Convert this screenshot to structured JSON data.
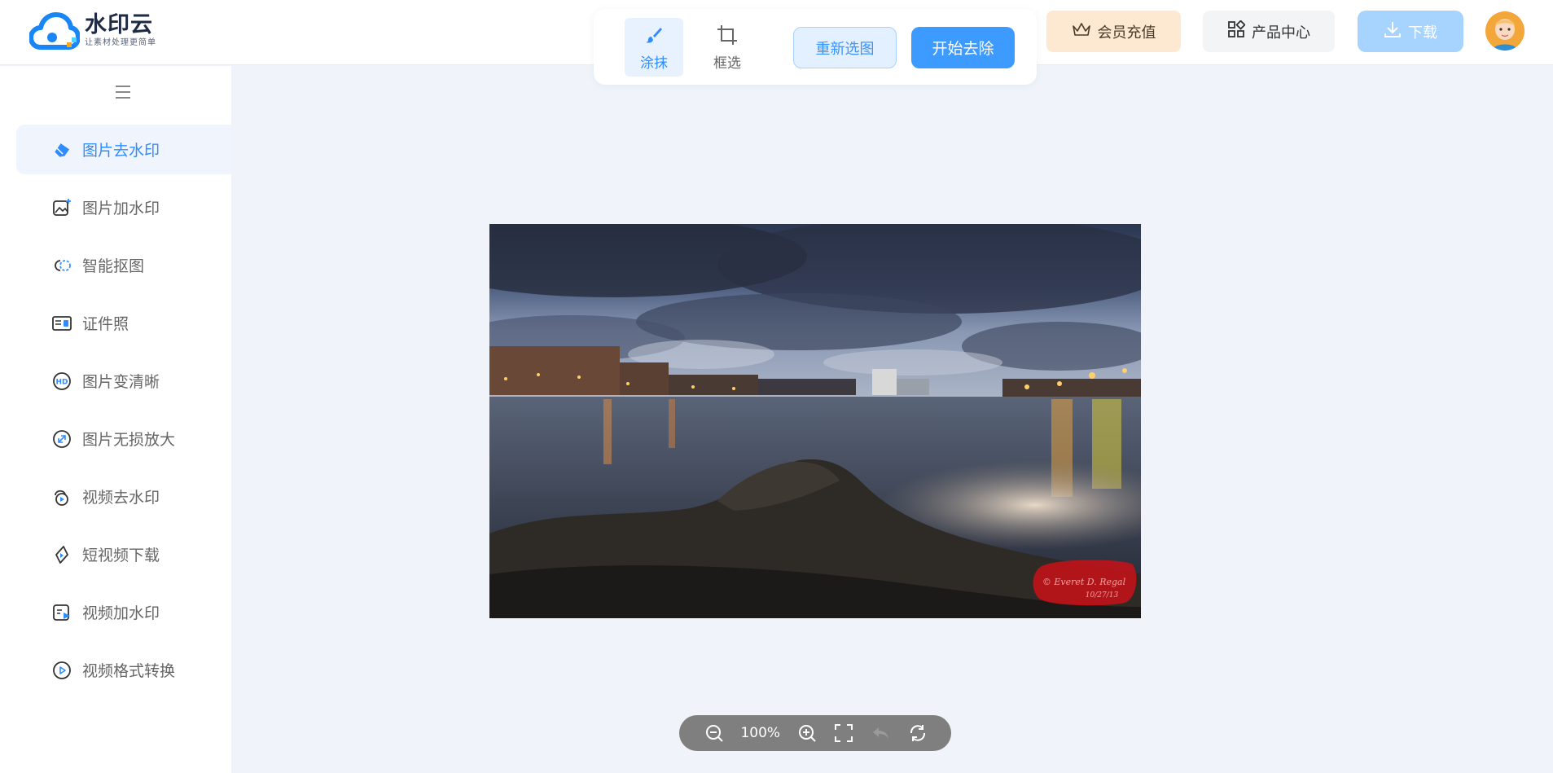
{
  "logo": {
    "name": "水印云",
    "slogan": "让素材处理更简单"
  },
  "toolbar": {
    "tools": [
      {
        "label": "涂抹"
      },
      {
        "label": "框选"
      }
    ],
    "reselect_label": "重新选图",
    "start_label": "开始去除"
  },
  "header": {
    "vip_label": "会员充值",
    "product_label": "产品中心",
    "download_label": "下载"
  },
  "sidebar": {
    "items": [
      {
        "label": "图片去水印",
        "icon": "eraser-icon"
      },
      {
        "label": "图片加水印",
        "icon": "image-add-icon"
      },
      {
        "label": "智能抠图",
        "icon": "cutout-icon"
      },
      {
        "label": "证件照",
        "icon": "id-card-icon"
      },
      {
        "label": "图片变清晰",
        "icon": "hd-icon"
      },
      {
        "label": "图片无损放大",
        "icon": "enlarge-icon"
      },
      {
        "label": "视频去水印",
        "icon": "video-eraser-icon"
      },
      {
        "label": "短视频下载",
        "icon": "short-video-download-icon"
      },
      {
        "label": "视频加水印",
        "icon": "video-add-icon"
      },
      {
        "label": "视频格式转换",
        "icon": "video-convert-icon"
      }
    ]
  },
  "image": {
    "watermark_line1": "© Everet D. Regal",
    "watermark_line2": "10/27/13"
  },
  "zoom": {
    "level": "100%"
  },
  "colors": {
    "accent": "#3d9bff",
    "vip_bg": "#fde9d2",
    "download_bg": "#a7d3ff"
  }
}
